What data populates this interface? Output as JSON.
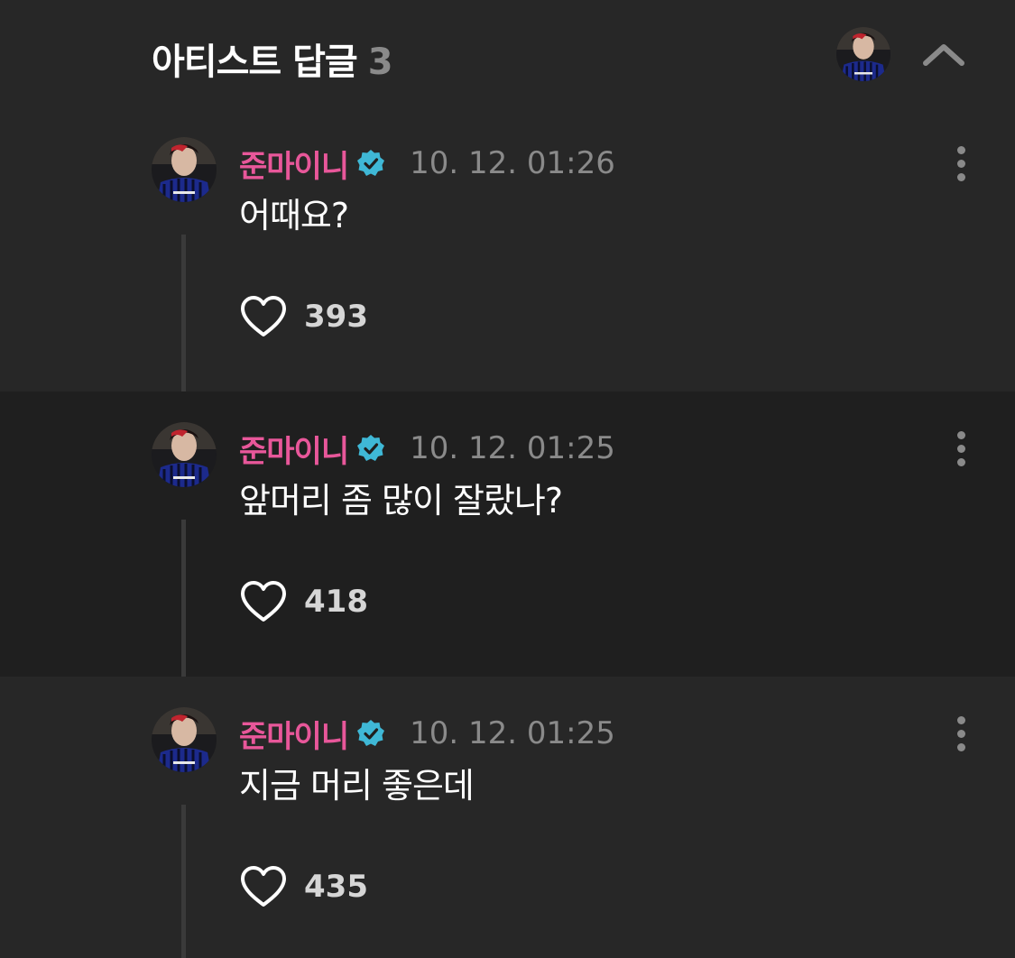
{
  "header": {
    "title": "아티스트 답글",
    "count": "3",
    "avatar_icon": "artist-avatar",
    "collapse_icon": "chevron-up-icon"
  },
  "colors": {
    "background": "#272727",
    "highlight_row": "#1f1f1f",
    "author": "#e8579a",
    "verified_badge": "#3fb8d6",
    "muted": "#8a8a8a"
  },
  "replies": [
    {
      "author": "준마이니",
      "timestamp": "10. 12. 01:26",
      "text": "어때요?",
      "likes": "393",
      "highlighted": false
    },
    {
      "author": "준마이니",
      "timestamp": "10. 12. 01:25",
      "text": "앞머리 좀 많이 잘랐나?",
      "likes": "418",
      "highlighted": true
    },
    {
      "author": "준마이니",
      "timestamp": "10. 12. 01:25",
      "text": "지금 머리 좋은데",
      "likes": "435",
      "highlighted": false
    }
  ]
}
